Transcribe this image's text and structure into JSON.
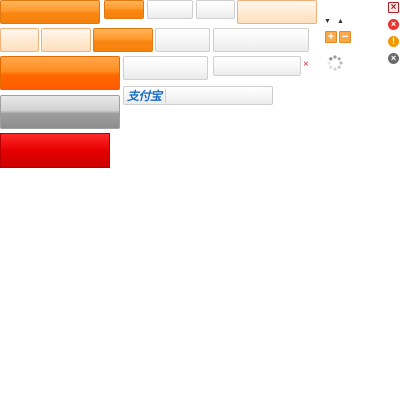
{
  "sprite": {
    "alipay_logo_text": "支付宝",
    "remove_glyph": "×",
    "plus_glyph": "+",
    "minus_glyph": "−",
    "caret_down_glyph": "▼",
    "caret_up_glyph": "▲",
    "exclamation_glyph": "!",
    "close_glyph": "×"
  },
  "colors": {
    "orange": "#f98712",
    "orange_light": "#ffe8cd",
    "grey_light": "#f0f0f0",
    "orange_strong": "#ff6a00",
    "grey_dark": "#9d9d9d",
    "red": "#e60000",
    "alipay_blue": "#1a6ec8",
    "icon_red": "#e8332f",
    "icon_orange": "#f39800",
    "icon_grey": "#6b6b6b"
  },
  "icons": [
    "close-outline-icon",
    "close-circle-icon",
    "warning-circle-icon",
    "close-circle-grey-icon",
    "caret-down-icon",
    "caret-up-icon",
    "plus-icon",
    "minus-icon",
    "loading-spinner-icon",
    "remove-x-icon"
  ]
}
